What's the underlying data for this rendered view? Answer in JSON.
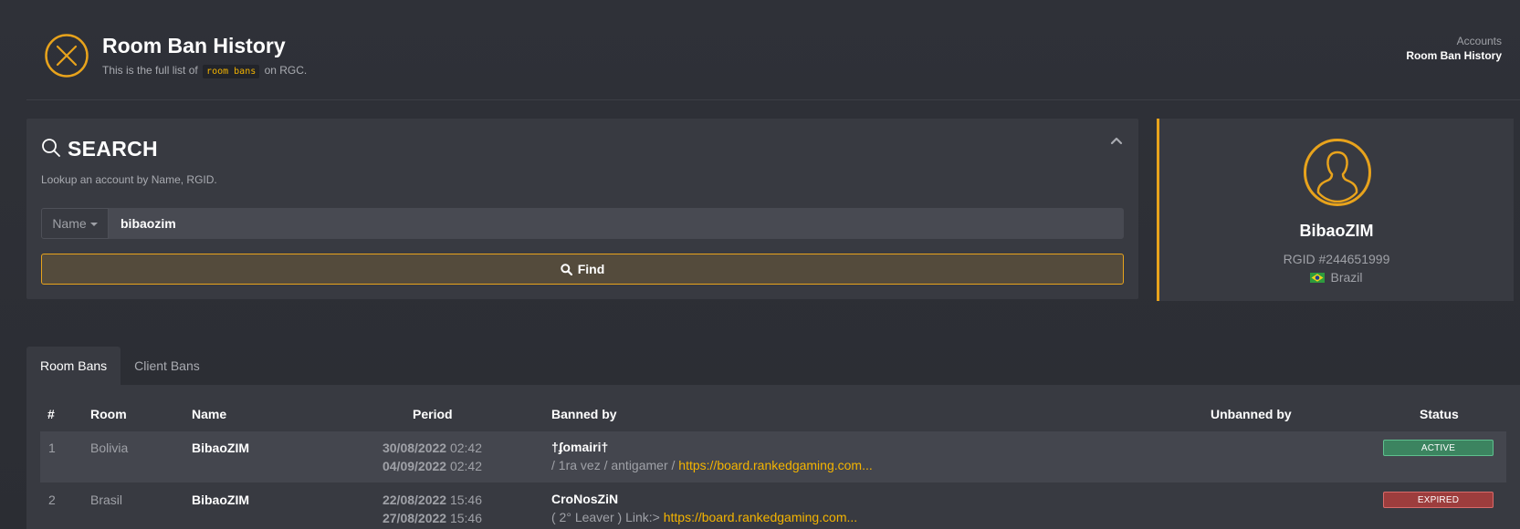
{
  "header": {
    "title": "Room Ban History",
    "subtitle_prefix": "This is the full list of",
    "subtitle_code": "room bans",
    "subtitle_suffix": "on RGC.",
    "breadcrumb_parent": "Accounts",
    "breadcrumb_current": "Room Ban History",
    "icon": "close-circle-icon",
    "accent_color": "#e8a31c"
  },
  "search": {
    "title": "SEARCH",
    "description": "Lookup an account by Name, RGID.",
    "field_selector": "Name",
    "query_value": "bibaozim",
    "find_label": "Find"
  },
  "profile": {
    "name": "BibaoZIM",
    "rgid": "RGID #244651999",
    "country": "Brazil",
    "avatar_icon": "user-avatar-icon"
  },
  "tabs": [
    {
      "label": "Room Bans",
      "active": true
    },
    {
      "label": "Client Bans",
      "active": false
    }
  ],
  "table": {
    "headers": {
      "num": "#",
      "room": "Room",
      "name": "Name",
      "period": "Period",
      "banned_by": "Banned by",
      "unbanned_by": "Unbanned by",
      "status": "Status"
    },
    "rows": [
      {
        "num": "1",
        "room": "Bolivia",
        "name": "BibaoZIM",
        "start_date": "30/08/2022",
        "start_time": "02:42",
        "end_date": "04/09/2022",
        "end_time": "02:42",
        "banned_by": "†ʄomairi†",
        "reason": "/ 1ra vez / antigamer / ",
        "link": "https://board.rankedgaming.com...",
        "unbanned_by": "",
        "status": "ACTIVE"
      },
      {
        "num": "2",
        "room": "Brasil",
        "name": "BibaoZIM",
        "start_date": "22/08/2022",
        "start_time": "15:46",
        "end_date": "27/08/2022",
        "end_time": "15:46",
        "banned_by": "CroNosZiN",
        "reason": "( 2° Leaver ) Link:> ",
        "link": "https://board.rankedgaming.com...",
        "unbanned_by": "",
        "status": "EXPIRED"
      }
    ]
  }
}
